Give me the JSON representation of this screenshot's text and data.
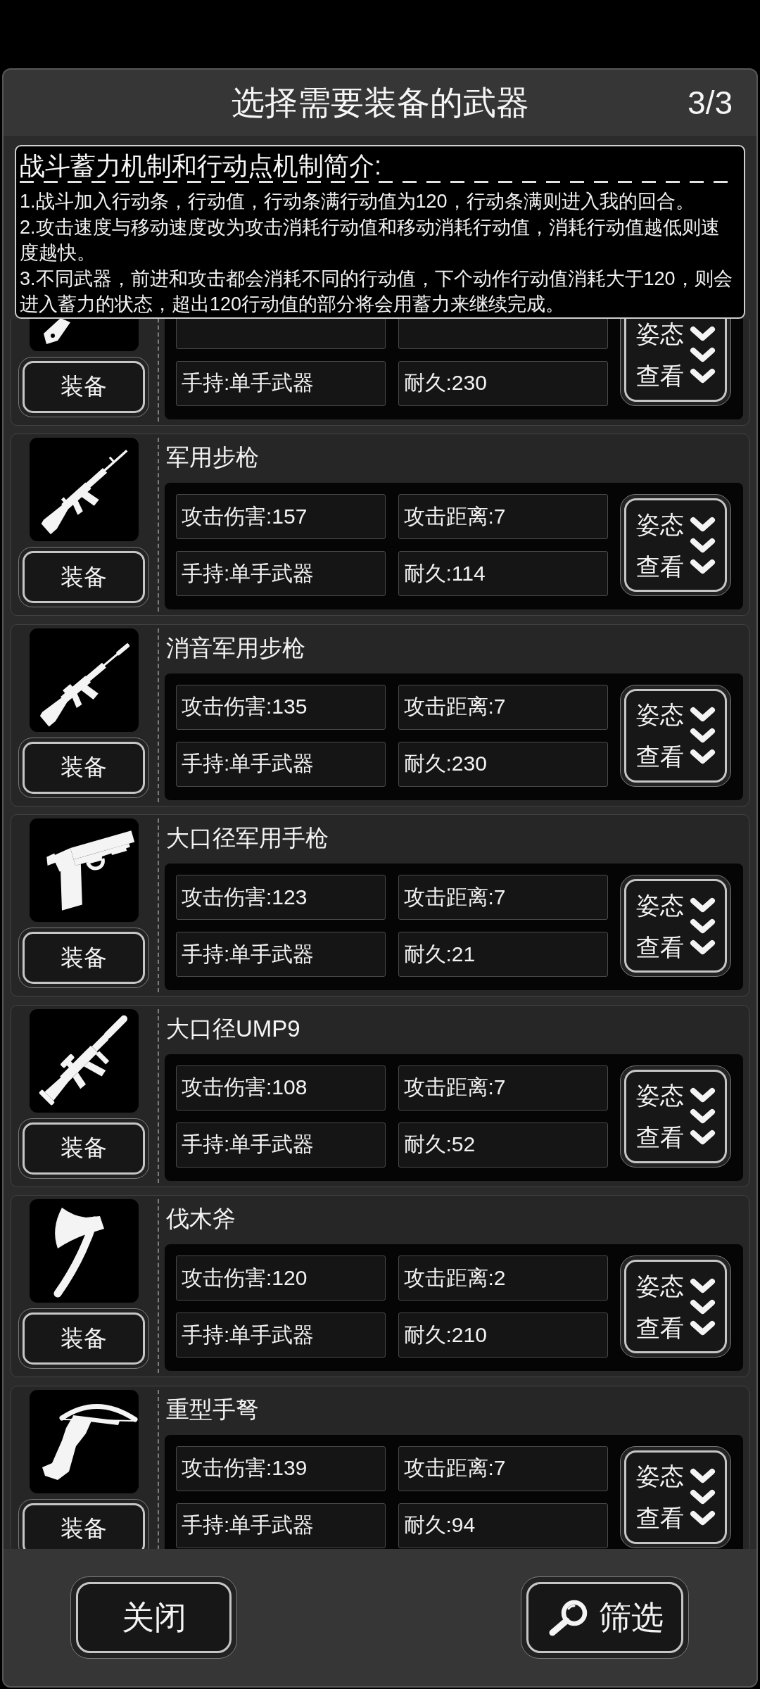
{
  "dialog": {
    "title": "选择需要装备的武器",
    "page": "3/3"
  },
  "info": {
    "title": "战斗蓄力机制和行动点机制简介:",
    "lines": [
      "1.战斗加入行动条，行动值，行动条满行动值为120，行动条满则进入我的回合。",
      "2.攻击速度与移动速度改为攻击消耗行动值和移动消耗行动值，消耗行动值越低则速度越快。",
      "3.不同武器，前进和攻击都会消耗不同的行动值，下个动作行动值消耗大于120，则会进入蓄力的状态，超出120行动值的部分将会用蓄力来继续完成。"
    ]
  },
  "weapons": [
    {
      "kind": "partial",
      "equip": "装备",
      "stats": [
        "手持:单手武器",
        "耐久:230"
      ],
      "view": [
        "姿态",
        "查看"
      ]
    },
    {
      "kind": "full",
      "name": "军用步枪",
      "equip": "装备",
      "stats": [
        "攻击伤害:157",
        "攻击距离:7",
        "手持:单手武器",
        "耐久:114"
      ],
      "view": [
        "姿态",
        "查看"
      ]
    },
    {
      "kind": "full",
      "name": "消音军用步枪",
      "equip": "装备",
      "stats": [
        "攻击伤害:135",
        "攻击距离:7",
        "手持:单手武器",
        "耐久:230"
      ],
      "view": [
        "姿态",
        "查看"
      ]
    },
    {
      "kind": "full",
      "name": "大口径军用手枪",
      "equip": "装备",
      "stats": [
        "攻击伤害:123",
        "攻击距离:7",
        "手持:单手武器",
        "耐久:21"
      ],
      "view": [
        "姿态",
        "查看"
      ]
    },
    {
      "kind": "full",
      "name": "大口径UMP9",
      "equip": "装备",
      "stats": [
        "攻击伤害:108",
        "攻击距离:7",
        "手持:单手武器",
        "耐久:52"
      ],
      "view": [
        "姿态",
        "查看"
      ]
    },
    {
      "kind": "full",
      "name": "伐木斧",
      "equip": "装备",
      "stats": [
        "攻击伤害:120",
        "攻击距离:2",
        "手持:单手武器",
        "耐久:210"
      ],
      "view": [
        "姿态",
        "查看"
      ]
    },
    {
      "kind": "full",
      "name": "重型手弩",
      "equip": "装备",
      "stats": [
        "攻击伤害:139",
        "攻击距离:7",
        "手持:单手武器",
        "耐久:94"
      ],
      "view": [
        "姿态",
        "查看"
      ]
    }
  ],
  "footer": {
    "close": "关闭",
    "filter": "筛选"
  }
}
